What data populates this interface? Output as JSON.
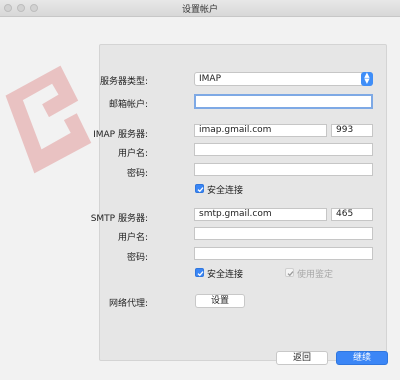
{
  "window": {
    "title": "设置帐户"
  },
  "form": {
    "server_type_label": "服务器类型:",
    "server_type_value": "IMAP",
    "email_label": "邮箱帐户:",
    "email_value": "",
    "imap": {
      "server_label": "IMAP 服务器:",
      "server_value": "imap.gmail.com",
      "port_value": "993",
      "username_label": "用户名:",
      "username_value": "",
      "password_label": "密码:",
      "password_value": "",
      "secure_label": "安全连接",
      "secure_checked": true
    },
    "smtp": {
      "server_label": "SMTP 服务器:",
      "server_value": "smtp.gmail.com",
      "port_value": "465",
      "username_label": "用户名:",
      "username_value": "",
      "password_label": "密码:",
      "password_value": "",
      "secure_label": "安全连接",
      "secure_checked": true,
      "auth_label": "使用鉴定",
      "auth_checked": true,
      "auth_disabled": true
    },
    "proxy_label": "网络代理:",
    "proxy_button": "设置"
  },
  "footer": {
    "back_button": "返回",
    "continue_button": "继续"
  },
  "colors": {
    "accent": "#3b86f6",
    "logo": "#d96a6a"
  }
}
